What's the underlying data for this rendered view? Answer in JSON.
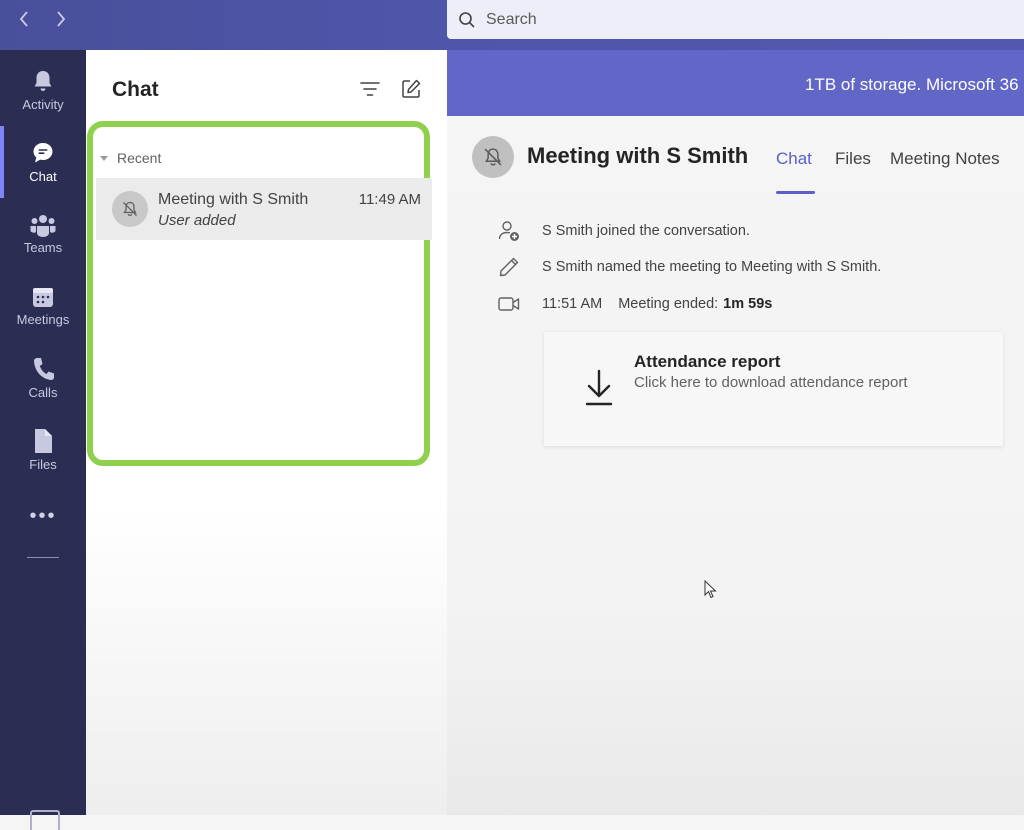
{
  "search": {
    "placeholder": "Search"
  },
  "rail": {
    "items": [
      {
        "label": "Activity",
        "icon": "bell-icon"
      },
      {
        "label": "Chat",
        "icon": "chat-icon",
        "active": true
      },
      {
        "label": "Teams",
        "icon": "teams-icon"
      },
      {
        "label": "Meetings",
        "icon": "calendar-icon"
      },
      {
        "label": "Calls",
        "icon": "phone-icon"
      },
      {
        "label": "Files",
        "icon": "file-icon"
      }
    ],
    "more": "•••"
  },
  "chat_pane": {
    "title": "Chat",
    "section": "Recent",
    "items": [
      {
        "name": "Meeting with S Smith",
        "time": "11:49 AM",
        "preview": "User added"
      }
    ]
  },
  "banner": {
    "text": "1TB of storage. Microsoft 36"
  },
  "meeting": {
    "title": "Meeting with S Smith",
    "tabs": [
      {
        "label": "Chat",
        "active": true
      },
      {
        "label": "Files"
      },
      {
        "label": "Meeting Notes"
      }
    ],
    "events": [
      {
        "icon": "person-add-icon",
        "text": "S Smith joined the conversation."
      },
      {
        "icon": "pencil-icon",
        "text": "S Smith named the meeting to Meeting with S Smith."
      },
      {
        "icon": "video-icon",
        "time": "11:51 AM",
        "text": "Meeting ended:",
        "duration": "1m 59s"
      }
    ],
    "attendance_card": {
      "title": "Attendance report",
      "subtitle": "Click here to download attendance report"
    }
  },
  "colors": {
    "rail": "#2c2d52",
    "titlebar": "#4f55a8",
    "banner": "#6166c7",
    "accent": "#5b5fc7",
    "highlight": "#8fd14f"
  }
}
